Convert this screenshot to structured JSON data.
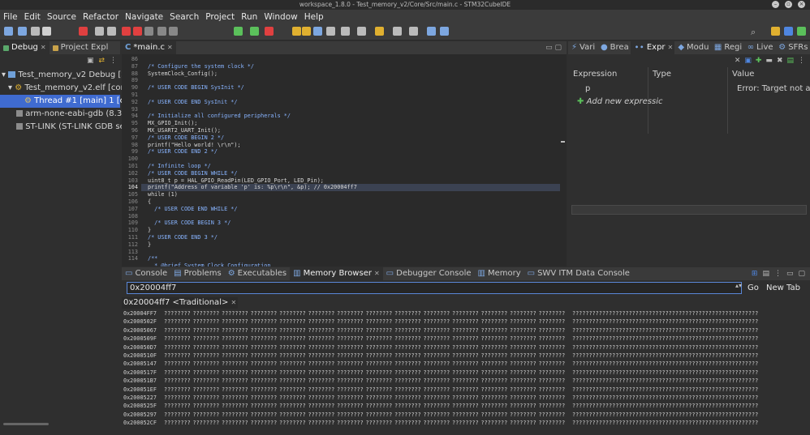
{
  "window": {
    "title": "workspace_1.8.0 - Test_memory_v2/Core/Src/main.c - STM32CubeIDE"
  },
  "menu": [
    "File",
    "Edit",
    "Source",
    "Refactor",
    "Navigate",
    "Search",
    "Project",
    "Run",
    "Window",
    "Help"
  ],
  "left": {
    "tabs": [
      {
        "label": "Debug"
      },
      {
        "label": "Project Expl"
      }
    ],
    "tree": [
      {
        "label": "Test_memory_v2 Debug [STM"
      },
      {
        "label": "Test_memory_v2.elf [cores"
      },
      {
        "label": "Thread #1 [main] 1 [core"
      },
      {
        "label": "arm-none-eabi-gdb (8.3.1.2"
      },
      {
        "label": "ST-LINK (ST-LINK GDB serv"
      }
    ]
  },
  "editor": {
    "tab": "*main.c",
    "lines": [
      {
        "n": "86",
        "t": ""
      },
      {
        "n": "87",
        "t": "/* Configure the system clock */",
        "c": "cmt"
      },
      {
        "n": "88",
        "t": "SystemClock_Config();"
      },
      {
        "n": "89",
        "t": ""
      },
      {
        "n": "90",
        "t": "/* USER CODE BEGIN SysInit */",
        "c": "cmt"
      },
      {
        "n": "91",
        "t": ""
      },
      {
        "n": "92",
        "t": "/* USER CODE END SysInit */",
        "c": "cmt"
      },
      {
        "n": "93",
        "t": ""
      },
      {
        "n": "94",
        "t": "/* Initialize all configured peripherals */",
        "c": "cmt"
      },
      {
        "n": "95",
        "t": "MX_GPIO_Init();"
      },
      {
        "n": "96",
        "t": "MX_USART2_UART_Init();"
      },
      {
        "n": "97",
        "t": "/* USER CODE BEGIN 2 */",
        "c": "cmt"
      },
      {
        "n": "98",
        "t": "printf(\"Hello world! \\r\\n\");"
      },
      {
        "n": "99",
        "t": "/* USER CODE END 2 */",
        "c": "cmt"
      },
      {
        "n": "100",
        "t": ""
      },
      {
        "n": "101",
        "t": "/* Infinite loop */",
        "c": "cmt"
      },
      {
        "n": "102",
        "t": "/* USER CODE BEGIN WHILE */",
        "c": "cmt"
      },
      {
        "n": "103",
        "t": "uint8_t p = HAL_GPIO_ReadPin(LED_GPIO_Port, LED_Pin);"
      },
      {
        "n": "104",
        "t": "printf(\"Address of variable 'p' is: %p\\r\\n\", &p); // 0x20004ff7",
        "hl": true
      },
      {
        "n": "105",
        "t": "while (1)"
      },
      {
        "n": "106",
        "t": "{"
      },
      {
        "n": "107",
        "t": "  /* USER CODE END WHILE */",
        "c": "cmt"
      },
      {
        "n": "108",
        "t": ""
      },
      {
        "n": "109",
        "t": "  /* USER CODE BEGIN 3 */",
        "c": "cmt"
      },
      {
        "n": "110",
        "t": "}"
      },
      {
        "n": "111",
        "t": "/* USER CODE END 3 */",
        "c": "cmt"
      },
      {
        "n": "112",
        "t": "}"
      },
      {
        "n": "113",
        "t": ""
      },
      {
        "n": "114",
        "t": "/**",
        "c": "cmt"
      },
      {
        "n": "",
        "t": "  * @brief System Clock Configuration",
        "c": "cmt"
      }
    ]
  },
  "right": {
    "tabs": [
      "Vari",
      "Brea",
      "Expr",
      "Modu",
      "Regi",
      "Live",
      "SFRs"
    ],
    "columns": [
      "Expression",
      "Type",
      "Value"
    ],
    "rows": [
      {
        "expr": "p",
        "type": "",
        "value": "Error: Target not ava"
      }
    ],
    "add_label": "Add new expressic"
  },
  "bottom": {
    "tabs": [
      "Console",
      "Problems",
      "Executables",
      "Memory Browser",
      "Debugger Console",
      "Memory",
      "SWV ITM Data Console"
    ],
    "address_value": "0x20004ff7",
    "go_label": "Go",
    "newtab_label": "New Tab",
    "subtab": "0x20004ff7 <Traditional>",
    "hex_cell": "????????",
    "ascii": "????????????????????????????????????????????????????????",
    "rows": [
      "0x20004FF7",
      "0x2000502F",
      "0x20005067",
      "0x2000509F",
      "0x200050D7",
      "0x2000510F",
      "0x20005147",
      "0x2000517F",
      "0x200051B7",
      "0x200051EF",
      "0x20005227",
      "0x2000525F",
      "0x20005297",
      "0x200052CF"
    ]
  }
}
